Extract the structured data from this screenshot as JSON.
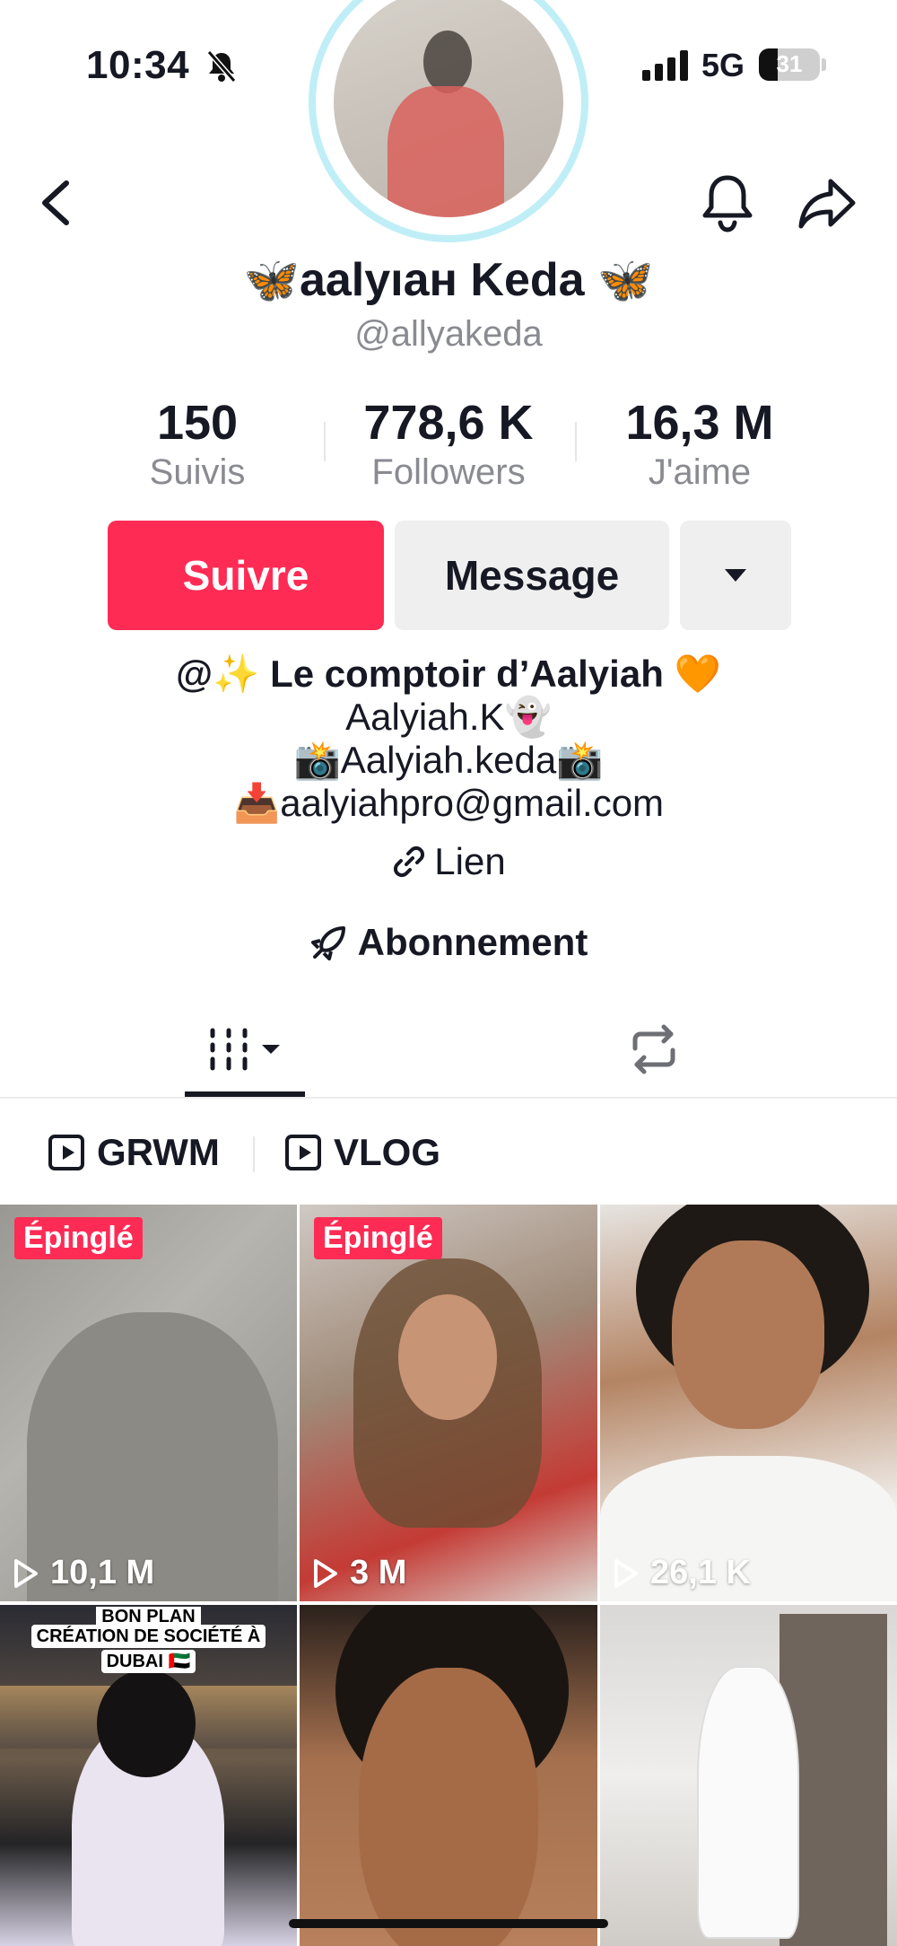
{
  "status_bar": {
    "time": "10:34",
    "network": "5G",
    "battery": "31",
    "battery_level": 0.31
  },
  "profile": {
    "display_name": "aalyıaн Keda",
    "name_emoji": "🦋",
    "handle": "@allyakeda"
  },
  "stats": [
    {
      "value": "150",
      "label": "Suivis"
    },
    {
      "value": "778,6 K",
      "label": "Followers"
    },
    {
      "value": "16,3 M",
      "label": "J'aime"
    }
  ],
  "actions": {
    "follow": "Suivre",
    "message": "Message"
  },
  "bio": {
    "line1_prefix": "@",
    "line1_emoji": "✨",
    "line1_text": " Le comptoir d’Aalyiah ",
    "line1_heart": "🧡",
    "line2": "Aalyiah.K",
    "line2_emoji": "👻",
    "line3_emoji": "📸",
    "line3": "Aalyiah.keda",
    "line4_emoji": "📥",
    "line4": "aalyiahpro@gmail.com"
  },
  "link_label": "Lien",
  "subscription_label": "Abonnement",
  "playlists": [
    {
      "label": "GRWM"
    },
    {
      "label": "VLOG"
    }
  ],
  "videos": [
    {
      "pinned_label": "Épinglé",
      "views": "10,1 M"
    },
    {
      "pinned_label": "Épinglé",
      "views": "3 M"
    },
    {
      "views": "26,1 K"
    },
    {
      "caption_lines": [
        "BON PLAN",
        "CRÉATION DE SOCIÉTÉ À",
        "DUBAI 🇦🇪"
      ]
    },
    {},
    {}
  ],
  "colors": {
    "accent": "#fe2c55",
    "secondary_button": "#efefef",
    "muted_text": "#8a8b91"
  }
}
